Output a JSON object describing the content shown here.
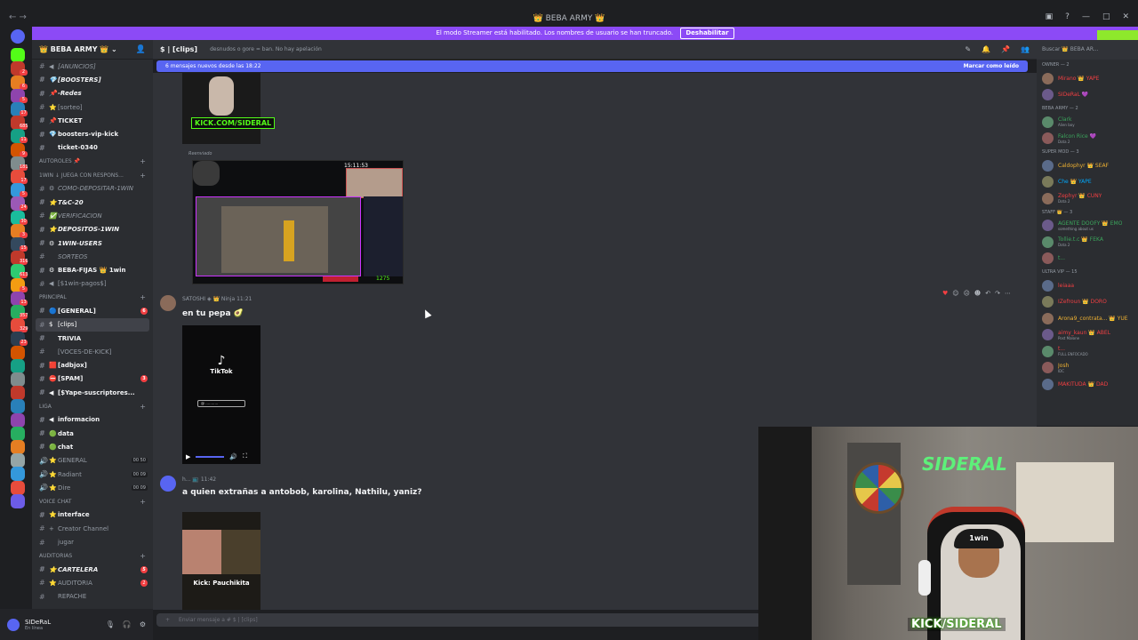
{
  "window": {
    "title": "👑 BEBA ARMY 👑"
  },
  "streamer_mode": {
    "message": "El modo Streamer está habilitado. Los nombres de usuario se han truncado.",
    "button": "Deshabilitar"
  },
  "rail": {
    "badges": [
      "2",
      "6",
      "5",
      "17",
      "685",
      "11",
      "9",
      "181",
      "17",
      "5",
      "24",
      "30",
      "3",
      "15",
      "316",
      "613",
      "5",
      "13",
      "357",
      "329",
      "23"
    ]
  },
  "guild": {
    "name": "👑 BEBA ARMY 👑"
  },
  "channels": [
    {
      "type": "ch",
      "emoji": "◀",
      "name": "[ANUNCIOS]",
      "style": "italic"
    },
    {
      "type": "ch",
      "emoji": "💎",
      "name": "[BOOSTERS]",
      "style": "bold italic"
    },
    {
      "type": "ch",
      "emoji": "📌",
      "name": "-Redes",
      "style": "bold italic"
    },
    {
      "type": "ch",
      "emoji": "⭐",
      "name": "[sorteo]",
      "style": ""
    },
    {
      "type": "ch",
      "emoji": "📌",
      "name": "TICKET",
      "style": "bold"
    },
    {
      "type": "ch",
      "emoji": "💎",
      "name": "boosters-vip-kick",
      "style": "bold"
    },
    {
      "type": "ch",
      "emoji": "",
      "name": "ticket-0340",
      "style": "bold"
    },
    {
      "type": "cat",
      "name": "AUTOROLES 📌"
    },
    {
      "type": "cat",
      "name": "1WIN ↓ JUEGA CON RESPONS..."
    },
    {
      "type": "ch",
      "emoji": "⚙",
      "name": "COMO-DEPOSITAR-1WIN",
      "style": "italic"
    },
    {
      "type": "ch",
      "emoji": "⭐",
      "name": "T&C-20",
      "style": "bold italic"
    },
    {
      "type": "ch",
      "emoji": "✅",
      "name": "VERIFICACION",
      "style": "italic"
    },
    {
      "type": "ch",
      "emoji": "⭐",
      "name": "DEPOSITOS-1WIN",
      "style": "bold italic"
    },
    {
      "type": "ch",
      "emoji": "⚙",
      "name": "1WIN-USERS",
      "style": "bold italic"
    },
    {
      "type": "ch",
      "emoji": "",
      "name": "SORTEOS",
      "style": "italic"
    },
    {
      "type": "ch",
      "emoji": "⚙",
      "name": "BEBA-FIJAS 👑 1win",
      "style": "bold"
    },
    {
      "type": "ch",
      "emoji": "◀",
      "name": "[$1win-pagos$]",
      "style": ""
    },
    {
      "type": "cat",
      "name": "PRINCIPAL"
    },
    {
      "type": "ch",
      "emoji": "🔵",
      "name": "[GENERAL]",
      "style": "bold",
      "count": "6"
    },
    {
      "type": "ch",
      "emoji": "$",
      "name": "[clips]",
      "style": "active"
    },
    {
      "type": "ch",
      "emoji": "",
      "name": "TRIVIA",
      "style": "bold"
    },
    {
      "type": "ch",
      "emoji": "",
      "name": "[VOCES-DE-KICK]",
      "style": ""
    },
    {
      "type": "ch",
      "emoji": "🟥",
      "name": "[adbjox]",
      "style": "bold"
    },
    {
      "type": "ch",
      "emoji": "⛔",
      "name": "[SPAM]",
      "style": "bold",
      "count": "3"
    },
    {
      "type": "ch",
      "emoji": "◀",
      "name": "[$Yape-suscriptores...",
      "style": "bold"
    },
    {
      "type": "cat",
      "name": "LIGA"
    },
    {
      "type": "ch",
      "emoji": "◀",
      "name": "informacion",
      "style": "bold"
    },
    {
      "type": "ch",
      "emoji": "🟢",
      "name": "data",
      "style": "bold"
    },
    {
      "type": "ch",
      "emoji": "🟢",
      "name": "chat",
      "style": "bold"
    },
    {
      "type": "ch",
      "emoji": "⭐",
      "name": "GENERAL",
      "style": "",
      "vc": "00 50"
    },
    {
      "type": "ch",
      "emoji": "⭐",
      "name": "Radiant",
      "style": "",
      "vc": "00 09"
    },
    {
      "type": "ch",
      "emoji": "⭐",
      "name": "Dire",
      "style": "",
      "vc": "00 09"
    },
    {
      "type": "cat",
      "name": "VOICE CHAT"
    },
    {
      "type": "ch",
      "emoji": "⭐",
      "name": "interface",
      "style": "bold"
    },
    {
      "type": "ch",
      "emoji": "+",
      "name": "Creator Channel",
      "style": ""
    },
    {
      "type": "ch",
      "emoji": "",
      "name": "jugar",
      "style": ""
    },
    {
      "type": "cat",
      "name": "AUDITORIAS"
    },
    {
      "type": "ch",
      "emoji": "⭐",
      "name": "CARTELERA",
      "style": "bold italic",
      "count": "5"
    },
    {
      "type": "ch",
      "emoji": "⭐",
      "name": "AUDITORIA",
      "style": "",
      "count": "2"
    },
    {
      "type": "ch",
      "emoji": "",
      "name": "REPACHE",
      "style": ""
    }
  ],
  "user_panel": {
    "name": "SIDeRaL",
    "status": "En línea"
  },
  "channel_header": {
    "name": "$ | [clips]",
    "topic": "desnudos o gore = ban. No hay apelación"
  },
  "search": {
    "placeholder": "Buscar 👑 BEBA AR..."
  },
  "new_messages": {
    "text": "6 mensajes nuevos desde las 18:22",
    "action": "Marcar como leído"
  },
  "messages": [
    {
      "media_label": "KICK.COM/SIDERAL",
      "forwarded": "Reenviado",
      "clip_time": "15:11:53",
      "footer": "1275"
    },
    {
      "author": "SATOSHI ◈ 👑 Ninja",
      "time": "11:21",
      "text": "en tu pepa 🥑",
      "tiktok": "TikTok",
      "tiktok_user": "@ ..........."
    },
    {
      "author": "h... 📺",
      "time": "11:42",
      "text": "a quien extrañas a antobob, karolina, Nathilu, yaniz?",
      "thumb_label": "Kick: Pauchikita"
    }
  ],
  "composer": {
    "placeholder": "Enviar mensaje a # $ | [clips]"
  },
  "members": [
    {
      "category": "OWNER — 2",
      "items": [
        {
          "name": "Mirano 👑 YAPE",
          "sub": "",
          "color": "#f23f42"
        },
        {
          "name": "SIDeRaL 💜",
          "sub": "",
          "color": "#f23f42"
        }
      ]
    },
    {
      "category": "BEBA ARMY — 2",
      "items": [
        {
          "name": "Clark",
          "sub": "Alien boy",
          "color": "#3ba55c"
        },
        {
          "name": "Falcon Rice 💜",
          "sub": "Dota 2",
          "color": "#3ba55c"
        }
      ]
    },
    {
      "category": "SUPER MOD — 3",
      "items": [
        {
          "name": "Caldophyr 👑 SEAF",
          "sub": "",
          "color": "#f0b232"
        },
        {
          "name": "Che 👑 YAPE",
          "sub": "",
          "color": "#00a8fc"
        },
        {
          "name": "Zephyr 👑 CUNY",
          "sub": "Dota 2",
          "color": "#f23f42"
        }
      ]
    },
    {
      "category": "STAFF 👑 — 3",
      "items": [
        {
          "name": "AGENTE DOOFY 👑 EMO",
          "sub": "something about us",
          "color": "#3ba55c"
        },
        {
          "name": "Tollie.t.c 👑 FEKA",
          "sub": "Dota 2",
          "color": "#3ba55c"
        },
        {
          "name": "t...",
          "sub": "",
          "color": "#3ba55c"
        }
      ]
    },
    {
      "category": "ULTRA VIP — 15",
      "items": [
        {
          "name": "leiaaa",
          "sub": "",
          "color": "#f23f42"
        },
        {
          "name": "IZefroun 👑 DORO",
          "sub": "",
          "color": "#f23f42"
        },
        {
          "name": "Arona9_contrata... 👑 YUE",
          "sub": "",
          "color": "#f0b232"
        },
        {
          "name": "aimy_kaun 👑 ABEL",
          "sub": "Post Malone",
          "color": "#f23f42"
        },
        {
          "name": "t...",
          "sub": "FULL ENFOCADO",
          "color": "#f23f42"
        },
        {
          "name": "Josh",
          "sub": "IDC",
          "color": "#f0b232"
        },
        {
          "name": "MAKITUDA 👑 DAD",
          "sub": "",
          "color": "#f23f42"
        }
      ]
    }
  ],
  "webcam": {
    "neon": "SIDERAL",
    "cap": "1win",
    "overlay": "KICK/SIDERAL"
  }
}
